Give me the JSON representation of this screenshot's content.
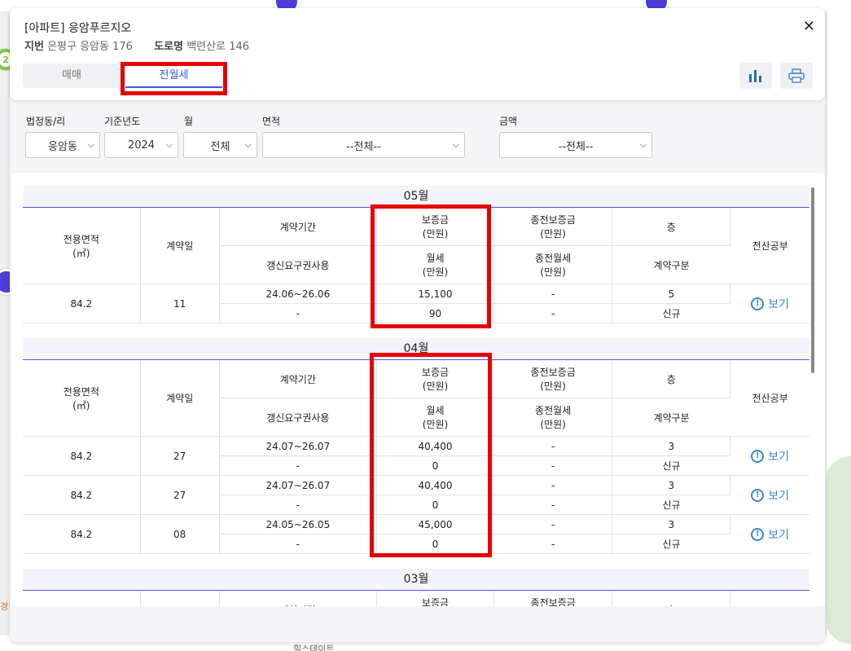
{
  "header": {
    "title": "[아파트] 응암푸르지오",
    "jibun_label": "지번",
    "jibun_value": "은평구 응암동 176",
    "road_label": "도로명",
    "road_value": "백련산로 146",
    "close_icon": "close-icon"
  },
  "tabs": [
    {
      "label": "매매",
      "active": false
    },
    {
      "label": "전월세",
      "active": true
    }
  ],
  "toolbar": {
    "chart_icon": "bar-chart-icon",
    "print_icon": "printer-icon"
  },
  "filters": {
    "dong": {
      "label": "법정동/리",
      "value": "응암동"
    },
    "year": {
      "label": "기준년도",
      "value": "2024"
    },
    "month": {
      "label": "월",
      "value": "전체"
    },
    "area": {
      "label": "면적",
      "value": "--전체--"
    },
    "amount": {
      "label": "금액",
      "value": "--전체--"
    }
  },
  "columns": {
    "area": "전용면적\n(㎡)",
    "date": "계약일",
    "period": "계약기간",
    "renewal": "갱신요구권사용",
    "deposit": "보증금\n(만원)",
    "rent": "월세\n(만원)",
    "prev_deposit": "종전보증금\n(만원)",
    "prev_rent": "종전월세\n(만원)",
    "floor": "층",
    "type": "계약구분",
    "doc": "전산공부"
  },
  "view_label": "보기",
  "months": [
    {
      "month": "05월",
      "rows": [
        {
          "area": "84.2",
          "day": "11",
          "period": "24.06~26.06",
          "renewal": "-",
          "deposit": "15,100",
          "rent": "90",
          "prev_deposit": "-",
          "prev_rent": "-",
          "floor": "5",
          "type": "신규"
        }
      ]
    },
    {
      "month": "04월",
      "rows": [
        {
          "area": "84.2",
          "day": "27",
          "period": "24.07~26.07",
          "renewal": "-",
          "deposit": "40,400",
          "rent": "0",
          "prev_deposit": "-",
          "prev_rent": "-",
          "floor": "3",
          "type": "신규"
        },
        {
          "area": "84.2",
          "day": "27",
          "period": "24.07~26.07",
          "renewal": "-",
          "deposit": "40,400",
          "rent": "0",
          "prev_deposit": "-",
          "prev_rent": "-",
          "floor": "3",
          "type": "신규"
        },
        {
          "area": "84.2",
          "day": "08",
          "period": "24.05~26.05",
          "renewal": "-",
          "deposit": "45,000",
          "rent": "0",
          "prev_deposit": "-",
          "prev_rent": "-",
          "floor": "3",
          "type": "신규"
        }
      ]
    },
    {
      "month": "03월",
      "rows": []
    }
  ],
  "map": {
    "label_1": "힐스테이트",
    "label_2": "경원"
  }
}
